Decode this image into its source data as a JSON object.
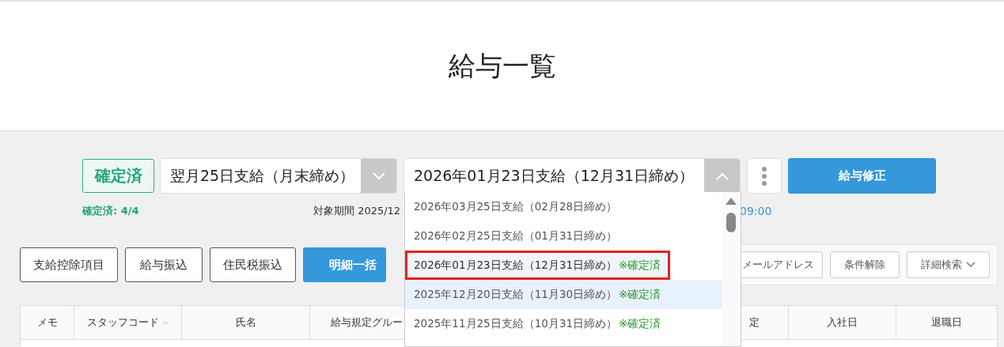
{
  "title": "給与一覧",
  "toolbar": {
    "status_badge": "確定済",
    "pay_rule_select": {
      "value": "翌月25日支給（月末締め）",
      "expanded": false
    },
    "pay_date_select": {
      "value": "2026年01月23日支給（12月31日締め）",
      "expanded": true
    },
    "action_button": "給与修正"
  },
  "info": {
    "confirmed_count": "確定済: 4/4",
    "period": "対象期間 2025/12",
    "time": "09:00"
  },
  "actions": [
    {
      "label": "支給控除項目",
      "kind": "outline"
    },
    {
      "label": "給与振込",
      "kind": "outline"
    },
    {
      "label": "住民税振込",
      "kind": "outline"
    },
    {
      "label": "明細一括",
      "kind": "primary"
    }
  ],
  "filter_buttons": [
    {
      "label": "メールアドレス",
      "dropdown": false
    },
    {
      "label": "条件解除",
      "dropdown": false
    },
    {
      "label": "詳細検索",
      "dropdown": true
    }
  ],
  "table": {
    "columns": [
      {
        "label": "メモ",
        "sortable": false
      },
      {
        "label": "スタッフコード",
        "sortable": true
      },
      {
        "label": "氏名",
        "sortable": false
      },
      {
        "label": "給与規定グルー",
        "sortable": false
      },
      {
        "label": "定",
        "sortable": false
      },
      {
        "label": "入社日",
        "sortable": false
      },
      {
        "label": "退職日",
        "sortable": false
      }
    ]
  },
  "dropdown": {
    "items": [
      {
        "label": "2026年03月25日支給（02月28日締め）",
        "selected": false,
        "hovered": false,
        "highlighted": false
      },
      {
        "label": "2026年02月25日支給（01月31日締め）",
        "selected": false,
        "hovered": false,
        "highlighted": false
      },
      {
        "label": "2026年01月23日支給（12月31日締め）",
        "status": "※確定済",
        "selected": true,
        "hovered": false,
        "highlighted": true
      },
      {
        "label": "2025年12月20日支給（11月30日締め）",
        "status": "※確定済",
        "selected": false,
        "hovered": true,
        "highlighted": false
      },
      {
        "label": "2025年11月25日支給（10月31日締め）",
        "status": "※確定済",
        "selected": false,
        "hovered": false,
        "highlighted": false
      }
    ]
  }
}
